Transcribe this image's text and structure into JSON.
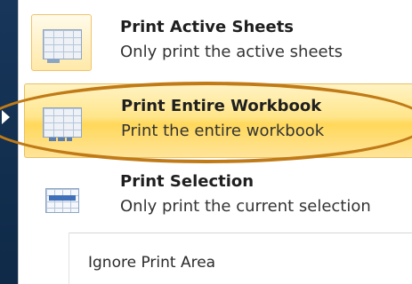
{
  "menu": {
    "items": [
      {
        "title": "Print Active Sheets",
        "description": "Only print the active sheets",
        "icon": "active-sheets-icon"
      },
      {
        "title": "Print Entire Workbook",
        "description": "Print the entire workbook",
        "icon": "entire-workbook-icon",
        "highlighted": true
      },
      {
        "title": "Print Selection",
        "description": "Only print the current selection",
        "icon": "selection-icon"
      }
    ],
    "ignore_print_area": "Ignore Print Area"
  },
  "colors": {
    "highlight": "#ffe58a",
    "annotation_ellipse": "#c07a16",
    "backdrop": "#17365a"
  }
}
